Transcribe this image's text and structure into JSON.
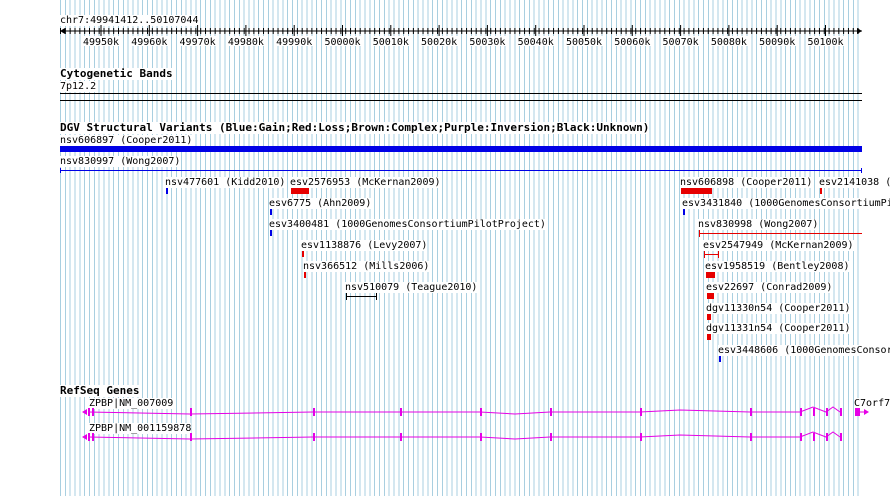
{
  "location": "chr7:49941412..50107044",
  "ruler": {
    "ticks": [
      "49950k",
      "49960k",
      "49970k",
      "49980k",
      "49990k",
      "50000k",
      "50010k",
      "50020k",
      "50030k",
      "50040k",
      "50050k",
      "50060k",
      "50070k",
      "50080k",
      "50090k",
      "50100k"
    ]
  },
  "cytoband": {
    "title": "Cytogenetic Bands",
    "band": "7p12.2"
  },
  "dgv": {
    "title": "DGV Structural Variants (Blue:Gain;Red:Loss;Brown:Complex;Purple:Inversion;Black:Unknown)",
    "colors": {
      "gain": "#0000e6",
      "loss": "#e60000",
      "unknown": "#000000"
    },
    "features": [
      {
        "label": "nsv606897 (Cooper2011)",
        "type": "gain"
      },
      {
        "label": "nsv830997 (Wong2007)",
        "type": "gain"
      },
      {
        "label": "nsv477601 (Kidd2010)",
        "type": "gain"
      },
      {
        "label": "esv2576953 (McKernan2009)",
        "type": "loss"
      },
      {
        "label": "esv6775 (Ahn2009)",
        "type": "gain"
      },
      {
        "label": "esv3400481 (1000GenomesConsortiumPilotProject)",
        "type": "gain"
      },
      {
        "label": "esv1138876 (Levy2007)",
        "type": "loss"
      },
      {
        "label": "nsv366512 (Mills2006)",
        "type": "loss"
      },
      {
        "label": "nsv510079 (Teague2010)",
        "type": "unknown"
      },
      {
        "label": "nsv606898 (Cooper2011)",
        "type": "loss"
      },
      {
        "label": "esv2141038 (",
        "type": "loss"
      },
      {
        "label": "esv3431840 (1000GenomesConsortiumPi",
        "type": "gain"
      },
      {
        "label": "nsv830998 (Wong2007)",
        "type": "loss"
      },
      {
        "label": "esv2547949 (McKernan2009)",
        "type": "loss"
      },
      {
        "label": "esv1958519 (Bentley2008)",
        "type": "loss"
      },
      {
        "label": "esv22697 (Conrad2009)",
        "type": "loss"
      },
      {
        "label": "dgv11330n54 (Cooper2011)",
        "type": "loss"
      },
      {
        "label": "dgv11331n54 (Cooper2011)",
        "type": "loss"
      },
      {
        "label": "esv3448606 (1000GenomesConsor",
        "type": "gain"
      }
    ]
  },
  "refseq": {
    "title": "RefSeq Genes",
    "color": "#e600e6",
    "genes": [
      {
        "label": "ZPBP|NM_007009"
      },
      {
        "label": "ZPBP|NM_001159878"
      },
      {
        "label": "C7orf7"
      }
    ]
  }
}
